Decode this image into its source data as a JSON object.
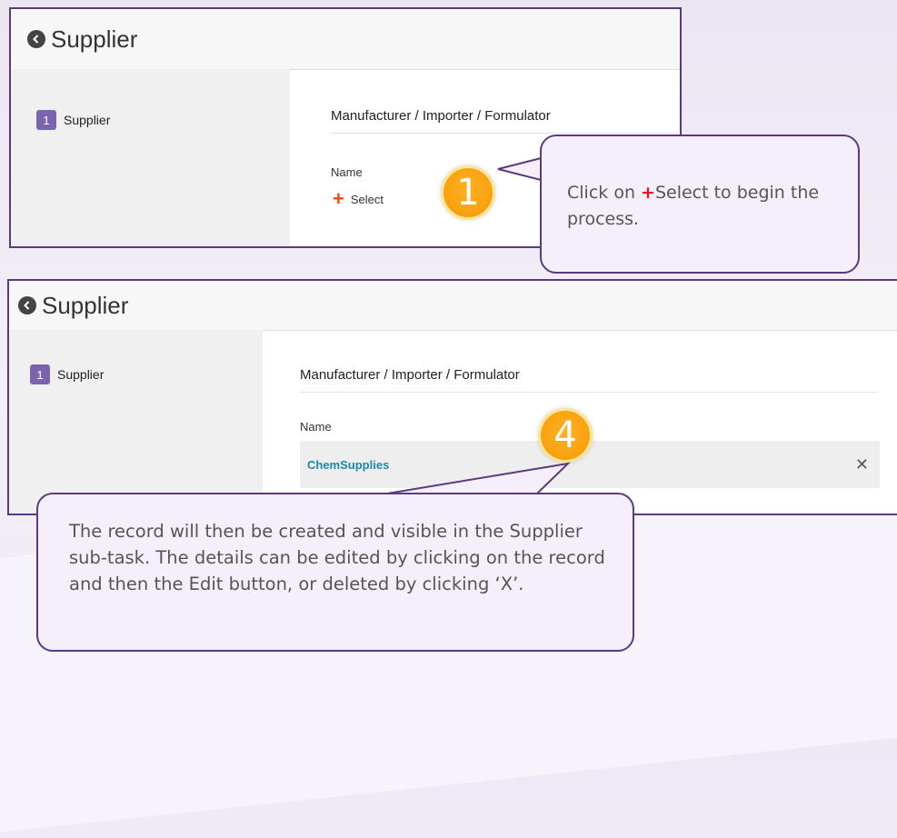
{
  "panel1": {
    "title": "Supplier",
    "step_number": "1",
    "step_label": "Supplier",
    "section_title": "Manufacturer / Importer / Formulator",
    "name_label": "Name",
    "select_label": "Select"
  },
  "panel2": {
    "title": "Supplier",
    "step_number": "1",
    "step_label": "Supplier",
    "section_title": "Manufacturer / Importer / Formulator",
    "name_label": "Name",
    "record_name": "ChemSupplies",
    "remove_label": "✕"
  },
  "markers": [
    "1",
    "4"
  ],
  "callout1": {
    "prefix": "Click on ",
    "plus": "+",
    "rest": "Select to begin the process."
  },
  "callout2": {
    "text": "The record will then be created and visible in the Supplier sub-task. The details can be edited by clicking on the record and then the Edit button, or deleted by clicking ‘X’."
  },
  "colors": {
    "frame": "#5b3a7e",
    "step_badge": "#7b64ad",
    "plus_orange": "#ff4500",
    "link_teal": "#1a8aa8",
    "marker_orange": "#f9a312",
    "callout_bg": "#f4effa"
  },
  "icons": [
    "back-arrow-icon",
    "plus-icon",
    "close-icon"
  ]
}
